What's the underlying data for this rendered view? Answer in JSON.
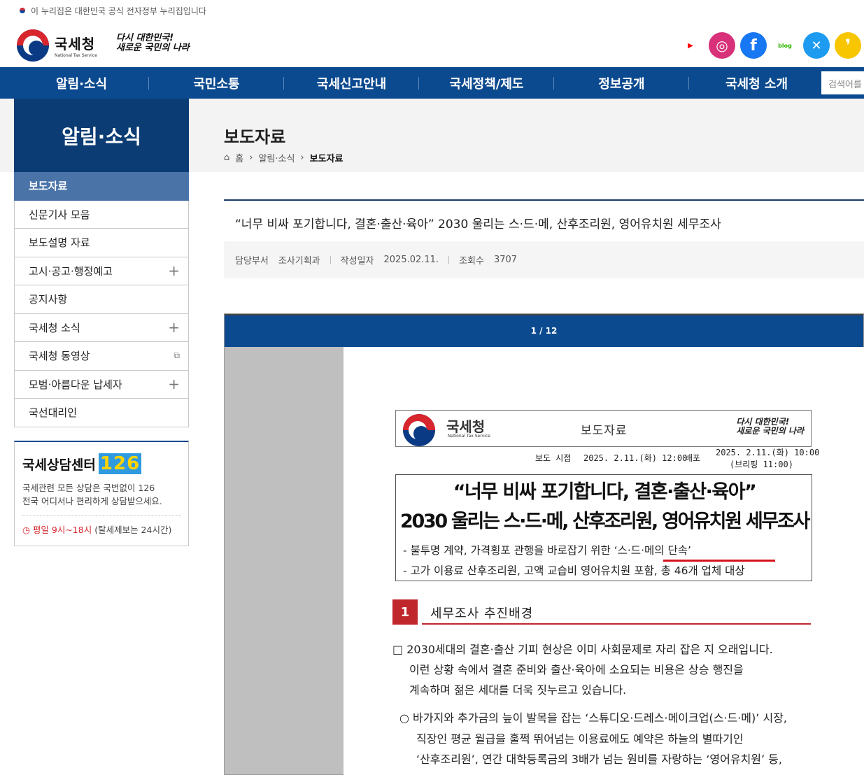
{
  "gov_banner": {
    "text": "이 누리집은 대한민국 공식 전자정부 누리집입니다"
  },
  "logo": {
    "name_ko": "국세청",
    "name_en": "National Tax Service",
    "slogan_line1": "다시 대한민국!",
    "slogan_line2": "새로운 국민의 나라"
  },
  "sns": [
    {
      "name": "youtube",
      "glyph": "▶",
      "color": "#ff0000"
    },
    {
      "name": "instagram",
      "glyph": "◎",
      "color": "#d8317a"
    },
    {
      "name": "facebook",
      "glyph": "f",
      "color": "#1877f2"
    },
    {
      "name": "blog",
      "glyph": "blog",
      "color": "#2db400"
    },
    {
      "name": "x",
      "glyph": "✕",
      "color": "#1d9bf0"
    },
    {
      "name": "kakao",
      "glyph": "❜",
      "color": "#f7c600"
    }
  ],
  "nav": {
    "items": [
      "알림·소식",
      "국민소통",
      "국세신고안내",
      "국세정책/제도",
      "정보공개",
      "국세청 소개"
    ],
    "search_placeholder": "검색어를"
  },
  "sidebar": {
    "title": "알림·소식",
    "items": [
      {
        "label": "보도자료",
        "active": true,
        "icon": ""
      },
      {
        "label": "신문기사 모음",
        "icon": ""
      },
      {
        "label": "보도설명 자료",
        "icon": ""
      },
      {
        "label": "고시·공고·행정예고",
        "icon": "+"
      },
      {
        "label": "공지사항",
        "icon": ""
      },
      {
        "label": "국세청 소식",
        "icon": "+"
      },
      {
        "label": "국세청 동영상",
        "icon": "⧉"
      },
      {
        "label": "모범·아름다운 납세자",
        "icon": "+"
      },
      {
        "label": "국선대리인",
        "icon": ""
      }
    ]
  },
  "consult": {
    "title": "국세상담센터",
    "number": "126",
    "desc_line1": "국세관련 모든 상담은 국번없이 126",
    "desc_line2": "전국 어디서나 편리하게 상담받으세요.",
    "hours": "평일 9시~18시",
    "hours_note": "(탈세제보는 24시간)"
  },
  "page": {
    "title": "보도자료",
    "breadcrumb": {
      "home": "홈",
      "level1": "알림·소식",
      "current": "보도자료"
    }
  },
  "article": {
    "title": "“너무 비싸 포기합니다, 결혼·출산·육아” 2030 울리는 스·드·메, 산후조리원, 영어유치원 세무조사",
    "meta": {
      "dept_label": "담당부서",
      "dept": "조사기획과",
      "date_label": "작성일자",
      "date": "2025.02.11.",
      "views_label": "조회수",
      "views": "3707"
    }
  },
  "viewer": {
    "page_indicator": "1 / 12",
    "doc": {
      "org": "국세청",
      "org_en": "National Tax Service",
      "kind": "보도자료",
      "slogan_line1": "다시 대한민국!",
      "slogan_line2": "새로운 국민의 나라",
      "release_label": "보도 시점",
      "release_time": "2025. 2.11.(화) 12:00",
      "dist_label": "배포",
      "dist_time": "2025. 2.11.(화) 10:00",
      "briefing": "(브리핑 11:00)",
      "headline1": "“너무 비싸 포기합니다, 결혼·출산·육아”",
      "headline2": "2030 울리는 스·드·메, 산후조리원, 영어유치원 세무조사",
      "sub1": "- 불투명 계약, 가격횡포 관행을 바로잡기 위한 ‘스·드·메의 단속’",
      "sub2": "- 고가 이용료 산후조리원, 고액 교습비 영어유치원 포함, 총 46개 업체 대상",
      "section_num": "1",
      "section_title": "세무조사 추진배경",
      "p1_l1": "□ 2030세대의 결혼·출산 기피 현상은 이미 사회문제로 자리 잡은 지 오래입니다.",
      "p1_l2": "이런 상황 속에서 결혼 준비와 출산·육아에 소요되는 비용은 상승 행진을",
      "p1_l3": "계속하며 젊은 세대를 더욱 짓누르고 있습니다.",
      "p2_l1": "○ 바가지와 추가금의 늪이 발목을 잡는 ‘스튜디오·드레스·메이크업(스·드·메)’ 시장,",
      "p2_l2": "직장인 평균 월급을 훌쩍 뛰어넘는 이용료에도 예약은 하늘의 별따기인",
      "p2_l3": "‘산후조리원’, 연간 대학등록금의 3배가 넘는 원비를 자랑하는 ‘영어유치원’ 등,"
    }
  }
}
